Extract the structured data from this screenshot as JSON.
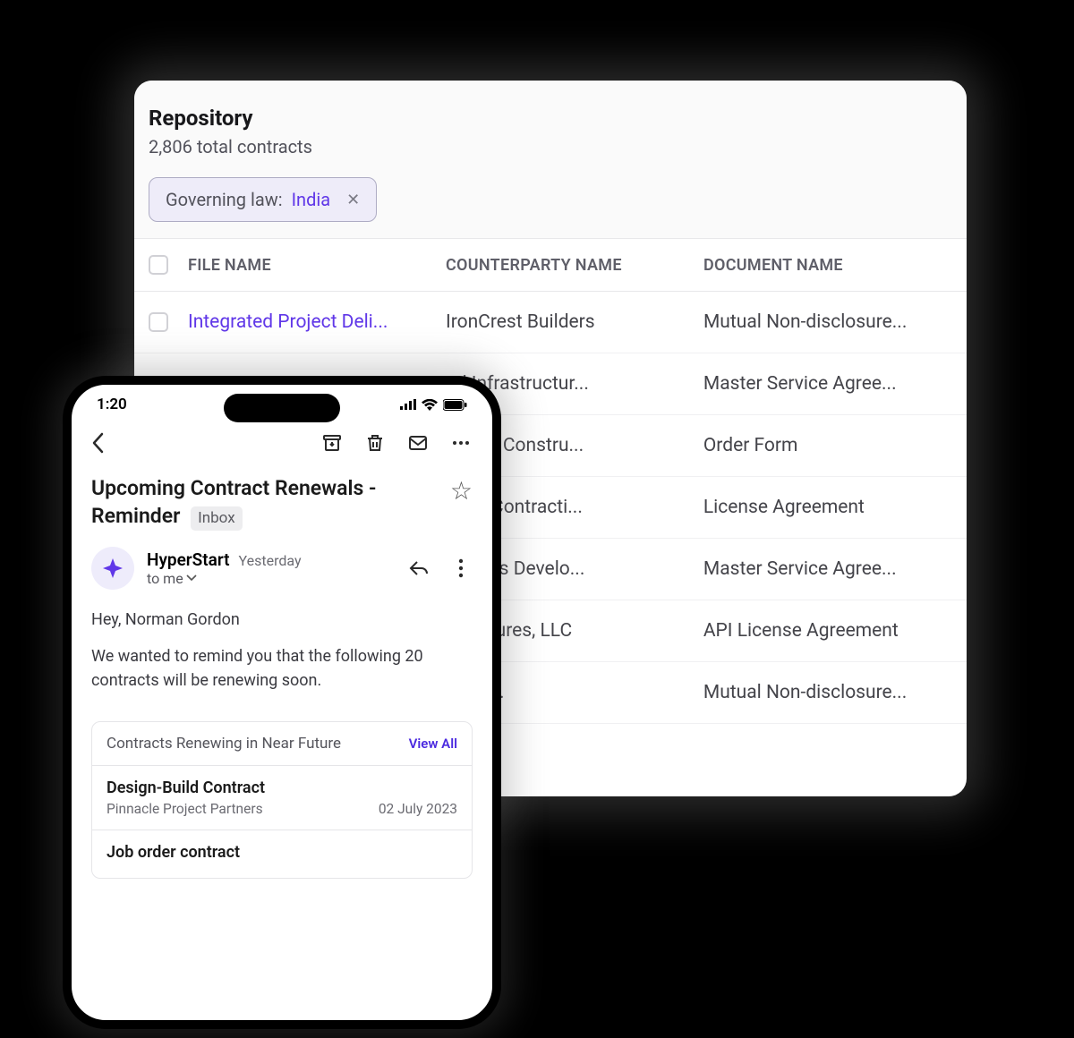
{
  "repo": {
    "title": "Repository",
    "subtitle": "2,806 total contracts",
    "filter": {
      "label": "Governing law: ",
      "value": "India"
    },
    "columns": {
      "file": "FILE NAME",
      "cp": "COUNTERPARTY NAME",
      "doc": "DOCUMENT NAME"
    },
    "rows": [
      {
        "file": "Integrated Project Deli...",
        "cp": "IronCrest Builders",
        "doc": "Mutual Non-disclosure..."
      },
      {
        "file": "",
        "cp": "od Infrastructur...",
        "doc": "Master Service Agree..."
      },
      {
        "file": "",
        "cp": "Works Constru...",
        "doc": "Order Form"
      },
      {
        "file": "",
        "cp": "rizon Contracti...",
        "doc": "License Agreement"
      },
      {
        "file": "",
        "cp": "& Riggs Develo...",
        "doc": "Master Service Agree..."
      },
      {
        "file": "",
        "cp": "Structures, LLC",
        "doc": "API License Agreement"
      },
      {
        "file": "",
        "cp": "e & Co.",
        "doc": "Mutual Non-disclosure..."
      }
    ]
  },
  "phone": {
    "time": "1:20",
    "subject": "Upcoming Contract Renewals - Reminder",
    "folder": "Inbox",
    "sender": "HyperStart",
    "mtime": "Yesterday",
    "recipient": "to me",
    "greeting": "Hey, Norman Gordon",
    "body": "We wanted to remind you that the following 20 contracts will be renewing soon.",
    "card_title": "Contracts Renewing in Near Future",
    "view_all": "View All",
    "items": [
      {
        "title": "Design-Build Contract",
        "party": "Pinnacle Project Partners",
        "date": "02 July 2023"
      },
      {
        "title": "Job order contract",
        "party": "",
        "date": ""
      }
    ]
  }
}
